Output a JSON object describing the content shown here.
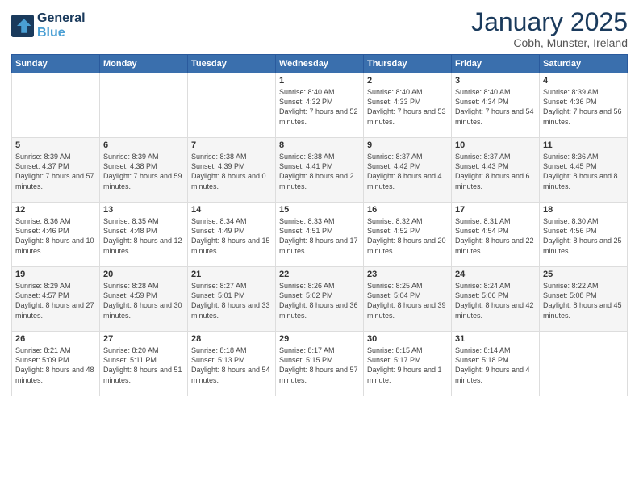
{
  "logo": {
    "line1": "General",
    "line2": "Blue"
  },
  "title": "January 2025",
  "location": "Cobh, Munster, Ireland",
  "days_of_week": [
    "Sunday",
    "Monday",
    "Tuesday",
    "Wednesday",
    "Thursday",
    "Friday",
    "Saturday"
  ],
  "weeks": [
    [
      {
        "day": "",
        "content": ""
      },
      {
        "day": "",
        "content": ""
      },
      {
        "day": "",
        "content": ""
      },
      {
        "day": "1",
        "content": "Sunrise: 8:40 AM\nSunset: 4:32 PM\nDaylight: 7 hours\nand 52 minutes."
      },
      {
        "day": "2",
        "content": "Sunrise: 8:40 AM\nSunset: 4:33 PM\nDaylight: 7 hours\nand 53 minutes."
      },
      {
        "day": "3",
        "content": "Sunrise: 8:40 AM\nSunset: 4:34 PM\nDaylight: 7 hours\nand 54 minutes."
      },
      {
        "day": "4",
        "content": "Sunrise: 8:39 AM\nSunset: 4:36 PM\nDaylight: 7 hours\nand 56 minutes."
      }
    ],
    [
      {
        "day": "5",
        "content": "Sunrise: 8:39 AM\nSunset: 4:37 PM\nDaylight: 7 hours\nand 57 minutes."
      },
      {
        "day": "6",
        "content": "Sunrise: 8:39 AM\nSunset: 4:38 PM\nDaylight: 7 hours\nand 59 minutes."
      },
      {
        "day": "7",
        "content": "Sunrise: 8:38 AM\nSunset: 4:39 PM\nDaylight: 8 hours\nand 0 minutes."
      },
      {
        "day": "8",
        "content": "Sunrise: 8:38 AM\nSunset: 4:41 PM\nDaylight: 8 hours\nand 2 minutes."
      },
      {
        "day": "9",
        "content": "Sunrise: 8:37 AM\nSunset: 4:42 PM\nDaylight: 8 hours\nand 4 minutes."
      },
      {
        "day": "10",
        "content": "Sunrise: 8:37 AM\nSunset: 4:43 PM\nDaylight: 8 hours\nand 6 minutes."
      },
      {
        "day": "11",
        "content": "Sunrise: 8:36 AM\nSunset: 4:45 PM\nDaylight: 8 hours\nand 8 minutes."
      }
    ],
    [
      {
        "day": "12",
        "content": "Sunrise: 8:36 AM\nSunset: 4:46 PM\nDaylight: 8 hours\nand 10 minutes."
      },
      {
        "day": "13",
        "content": "Sunrise: 8:35 AM\nSunset: 4:48 PM\nDaylight: 8 hours\nand 12 minutes."
      },
      {
        "day": "14",
        "content": "Sunrise: 8:34 AM\nSunset: 4:49 PM\nDaylight: 8 hours\nand 15 minutes."
      },
      {
        "day": "15",
        "content": "Sunrise: 8:33 AM\nSunset: 4:51 PM\nDaylight: 8 hours\nand 17 minutes."
      },
      {
        "day": "16",
        "content": "Sunrise: 8:32 AM\nSunset: 4:52 PM\nDaylight: 8 hours\nand 20 minutes."
      },
      {
        "day": "17",
        "content": "Sunrise: 8:31 AM\nSunset: 4:54 PM\nDaylight: 8 hours\nand 22 minutes."
      },
      {
        "day": "18",
        "content": "Sunrise: 8:30 AM\nSunset: 4:56 PM\nDaylight: 8 hours\nand 25 minutes."
      }
    ],
    [
      {
        "day": "19",
        "content": "Sunrise: 8:29 AM\nSunset: 4:57 PM\nDaylight: 8 hours\nand 27 minutes."
      },
      {
        "day": "20",
        "content": "Sunrise: 8:28 AM\nSunset: 4:59 PM\nDaylight: 8 hours\nand 30 minutes."
      },
      {
        "day": "21",
        "content": "Sunrise: 8:27 AM\nSunset: 5:01 PM\nDaylight: 8 hours\nand 33 minutes."
      },
      {
        "day": "22",
        "content": "Sunrise: 8:26 AM\nSunset: 5:02 PM\nDaylight: 8 hours\nand 36 minutes."
      },
      {
        "day": "23",
        "content": "Sunrise: 8:25 AM\nSunset: 5:04 PM\nDaylight: 8 hours\nand 39 minutes."
      },
      {
        "day": "24",
        "content": "Sunrise: 8:24 AM\nSunset: 5:06 PM\nDaylight: 8 hours\nand 42 minutes."
      },
      {
        "day": "25",
        "content": "Sunrise: 8:22 AM\nSunset: 5:08 PM\nDaylight: 8 hours\nand 45 minutes."
      }
    ],
    [
      {
        "day": "26",
        "content": "Sunrise: 8:21 AM\nSunset: 5:09 PM\nDaylight: 8 hours\nand 48 minutes."
      },
      {
        "day": "27",
        "content": "Sunrise: 8:20 AM\nSunset: 5:11 PM\nDaylight: 8 hours\nand 51 minutes."
      },
      {
        "day": "28",
        "content": "Sunrise: 8:18 AM\nSunset: 5:13 PM\nDaylight: 8 hours\nand 54 minutes."
      },
      {
        "day": "29",
        "content": "Sunrise: 8:17 AM\nSunset: 5:15 PM\nDaylight: 8 hours\nand 57 minutes."
      },
      {
        "day": "30",
        "content": "Sunrise: 8:15 AM\nSunset: 5:17 PM\nDaylight: 9 hours\nand 1 minute."
      },
      {
        "day": "31",
        "content": "Sunrise: 8:14 AM\nSunset: 5:18 PM\nDaylight: 9 hours\nand 4 minutes."
      },
      {
        "day": "",
        "content": ""
      }
    ]
  ]
}
